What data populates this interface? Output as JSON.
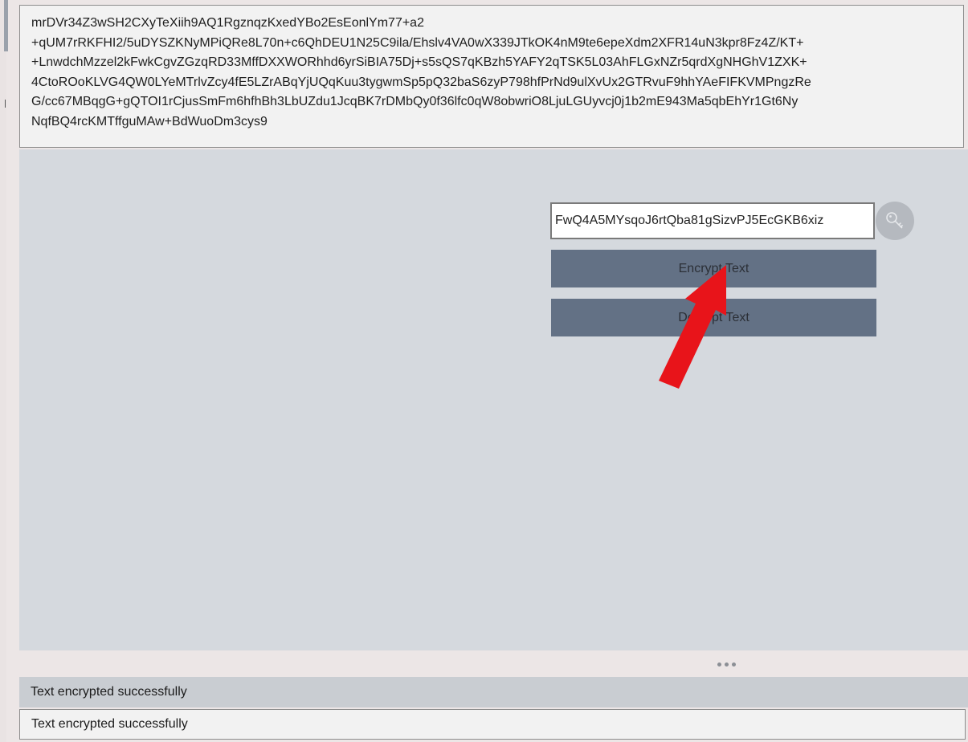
{
  "output": {
    "lines": [
      "mrDVr34Z3wSH2CXyTeXiih9AQ1RgznqzKxedYBo2EsEonlYm77+a2",
      "+qUM7rRKFHI2/5uDYSZKNyMPiQRe8L70n+c6QhDEU1N25C9ila/Ehslv4VA0wX339JTkOK4nM9te6epeXdm2XFR14uN3kpr8Fz4Z/KT+",
      "+LnwdchMzzel2kFwkCgvZGzqRD33MffDXXWORhhd6yrSiBIA75Dj+s5sQS7qKBzh5YAFY2qTSK5L03AhFLGxNZr5qrdXgNHGhV1ZXK+",
      "4CtoROoKLVG4QW0LYeMTrlvZcy4fE5LZrABqYjUQqKuu3tygwmSp5pQ32baS6zyP798hfPrNd9ulXvUx2GTRvuF9hhYAeFIFKVMPngzRe",
      "G/cc67MBqgG+gQTOI1rCjusSmFm6hfhBh3LbUZdu1JcqBK7rDMbQy0f36lfc0qW8obwriO8LjuLGUyvcj0j1b2mE943Ma5qbEhYr1Gt6Ny",
      "NqfBQ4rcKMTffguMAw+BdWuoDm3cys9"
    ]
  },
  "key": {
    "value": "FwQ4A5MYsqoJ6rtQba81gSizvPJ5EcGKB6xiz",
    "button_icon": "key-icon"
  },
  "actions": {
    "encrypt_label": "Encrypt Text",
    "decrypt_label": "Decrypt Text"
  },
  "status": {
    "bar_text": "Text encrypted successfully",
    "field_text": "Text encrypted successfully"
  },
  "colors": {
    "button_bg": "#637185",
    "arrow": "#e8141a",
    "panel_bg": "#d5d9de"
  }
}
